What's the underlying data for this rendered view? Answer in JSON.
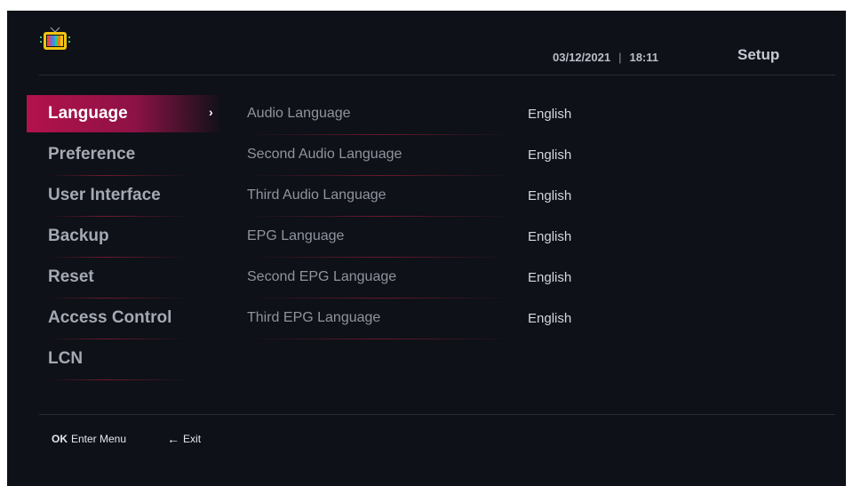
{
  "header": {
    "logo_icon": "tv-icon",
    "date": "03/12/2021",
    "separator": "|",
    "time": "18:11",
    "title": "Setup"
  },
  "sidebar": {
    "items": [
      {
        "label": "Language",
        "active": true
      },
      {
        "label": "Preference"
      },
      {
        "label": "User Interface"
      },
      {
        "label": "Backup"
      },
      {
        "label": "Reset"
      },
      {
        "label": "Access Control"
      },
      {
        "label": "LCN"
      }
    ],
    "chevron": "›"
  },
  "settings": [
    {
      "label": "Audio Language",
      "value": "English"
    },
    {
      "label": "Second Audio Language",
      "value": "English"
    },
    {
      "label": "Third Audio Language",
      "value": "English"
    },
    {
      "label": "EPG Language",
      "value": "English"
    },
    {
      "label": "Second EPG Language",
      "value": "English"
    },
    {
      "label": "Third EPG Language",
      "value": "English"
    }
  ],
  "footer": {
    "ok_key": "OK",
    "ok_hint": "Enter Menu",
    "exit_arrow": "←",
    "exit_hint": "Exit"
  },
  "colors": {
    "background": "#0e1117",
    "accent": "#b3124a",
    "divider": "#262b36"
  }
}
